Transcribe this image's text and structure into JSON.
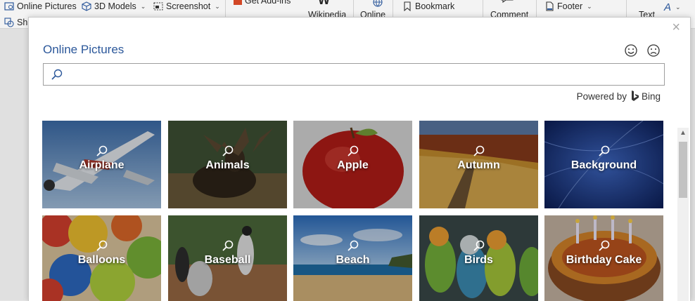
{
  "ribbon": {
    "online_pictures": "Online Pictures",
    "models_3d": "3D Models",
    "screenshot": "Screenshot",
    "get_addins": "Get Add-ins",
    "wikipedia": "Wikipedia",
    "online": "Online",
    "bookmark": "Bookmark",
    "comment": "Comment",
    "footer": "Footer",
    "text": "Text",
    "shapes_short": "Sh"
  },
  "dialog": {
    "title": "Online Pictures",
    "search_placeholder": "",
    "powered_by": "Powered by",
    "bing": "Bing"
  },
  "tiles": [
    {
      "label": "Airplane"
    },
    {
      "label": "Animals"
    },
    {
      "label": "Apple"
    },
    {
      "label": "Autumn"
    },
    {
      "label": "Background"
    },
    {
      "label": "Balloons"
    },
    {
      "label": "Baseball"
    },
    {
      "label": "Beach"
    },
    {
      "label": "Birds"
    },
    {
      "label": "Birthday Cake"
    }
  ],
  "colors": {
    "title_blue": "#2b579a",
    "ribbon_bg": "#f3f3f3"
  }
}
